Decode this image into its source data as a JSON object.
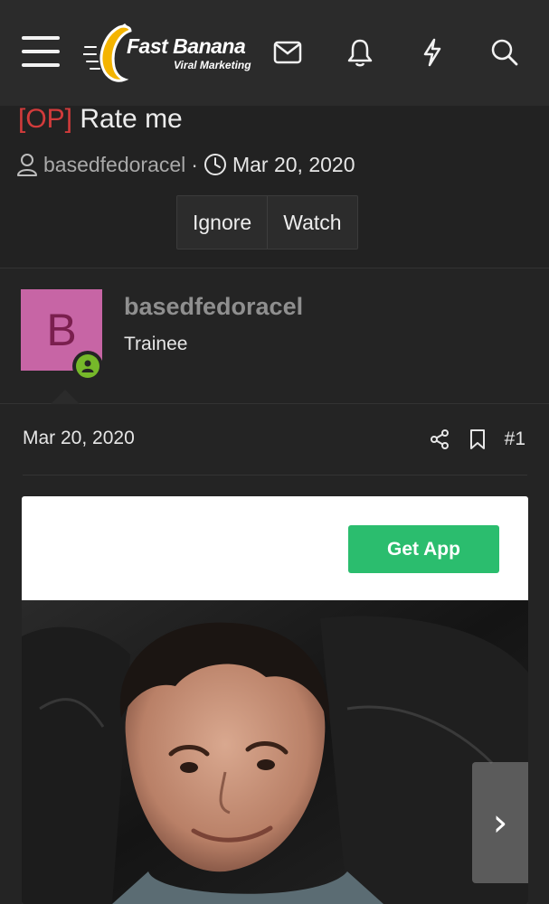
{
  "header": {
    "logo_title": "Fast Banana",
    "logo_subtitle": "Viral Marketing",
    "icons": [
      "menu-icon",
      "mail-icon",
      "bell-icon",
      "lightning-icon",
      "search-icon"
    ]
  },
  "thread": {
    "prefix": "[OP]",
    "title": "Rate me",
    "author": "basedfedoracel",
    "date": "Mar 20, 2020",
    "ignore_label": "Ignore",
    "watch_label": "Watch"
  },
  "post": {
    "avatar_letter": "B",
    "username": "basedfedoracel",
    "user_title": "Trainee",
    "date": "Mar 20, 2020",
    "post_number": "#1",
    "icons": [
      "share-icon",
      "bookmark-icon"
    ]
  },
  "embed": {
    "get_app_label": "Get App",
    "next_arrow": "›"
  },
  "colors": {
    "background": "#222222",
    "header": "#2b2b2b",
    "prefix_red": "#d23b3b",
    "avatar_bg": "#c765a5",
    "online_green": "#76b82a",
    "get_app_green": "#2bbd6e"
  }
}
